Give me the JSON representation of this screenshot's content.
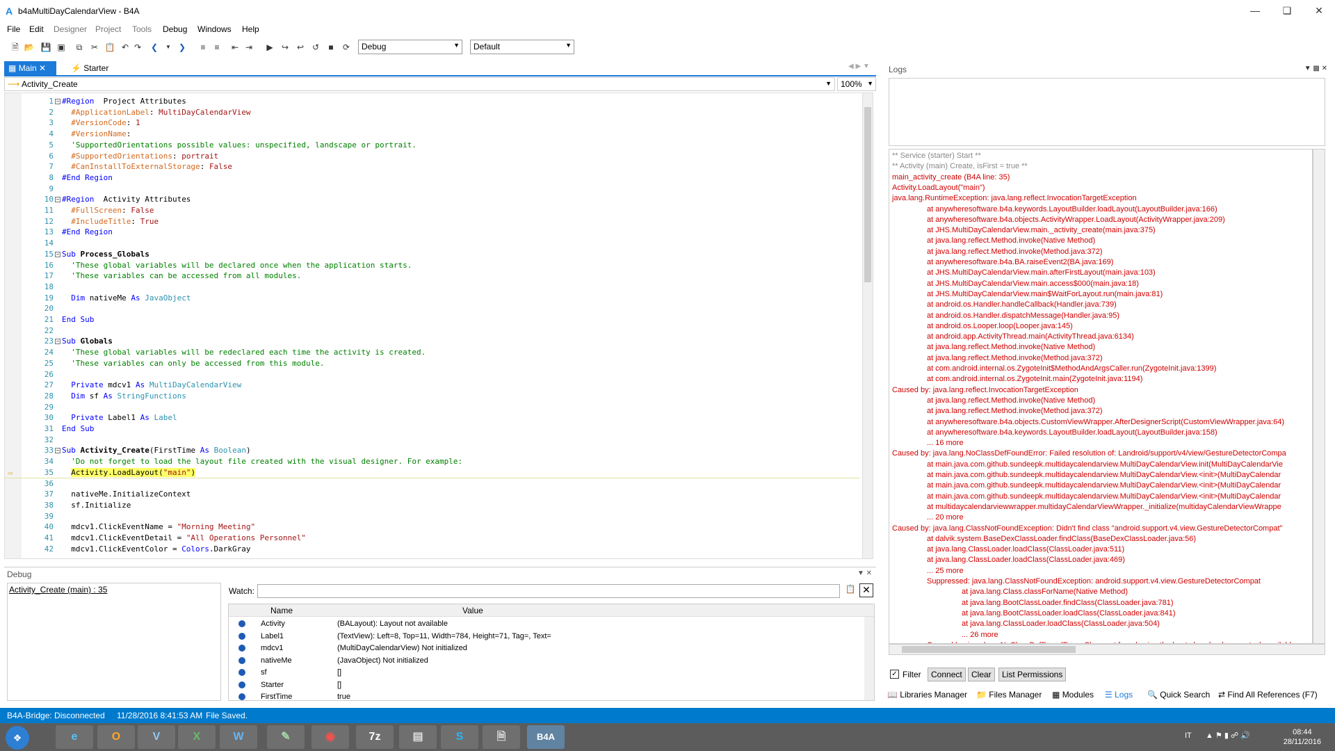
{
  "window": {
    "logo": "A",
    "title": "b4aMultiDayCalendarView - B4A"
  },
  "menu": [
    "File",
    "Edit",
    "Designer",
    "Project",
    "Tools",
    "Debug",
    "Windows",
    "Help"
  ],
  "toolbar": {
    "mode_combo": "Debug",
    "config_combo": "Default"
  },
  "tabs": [
    {
      "label": "Main"
    },
    {
      "label": "Starter"
    }
  ],
  "subs_combo": "Activity_Create",
  "zoom_combo": "100%",
  "code_lines": [
    {
      "n": "1",
      "html": "<span class=\"kw\">#Region</span>  Project Attributes"
    },
    {
      "n": "2",
      "html": "  <span class=\"pp\">#ApplicationLabel</span>: <span class=\"str\">MultiDayCalendarView</span>"
    },
    {
      "n": "3",
      "html": "  <span class=\"pp\">#VersionCode</span>: <span class=\"str\">1</span>"
    },
    {
      "n": "4",
      "html": "  <span class=\"pp\">#VersionName</span>:"
    },
    {
      "n": "5",
      "html": "  <span class=\"cm\">'SupportedOrientations possible values: unspecified, landscape or portrait.</span>"
    },
    {
      "n": "6",
      "html": "  <span class=\"pp\">#SupportedOrientations</span>: <span class=\"str\">portrait</span>"
    },
    {
      "n": "7",
      "html": "  <span class=\"pp\">#CanInstallToExternalStorage</span>: <span class=\"str\">False</span>"
    },
    {
      "n": "8",
      "html": "<span class=\"kw\">#End Region</span>"
    },
    {
      "n": "9",
      "html": ""
    },
    {
      "n": "10",
      "html": "<span class=\"kw\">#Region</span>  Activity Attributes"
    },
    {
      "n": "11",
      "html": "  <span class=\"pp\">#FullScreen</span>: <span class=\"str\">False</span>"
    },
    {
      "n": "12",
      "html": "  <span class=\"pp\">#IncludeTitle</span>: <span class=\"str\">True</span>"
    },
    {
      "n": "13",
      "html": "<span class=\"kw\">#End Region</span>"
    },
    {
      "n": "14",
      "html": ""
    },
    {
      "n": "15",
      "html": "<span class=\"kw\">Sub</span> <b>Process_Globals</b>"
    },
    {
      "n": "16",
      "html": "  <span class=\"cm\">'These global variables will be declared once when the application starts.</span>"
    },
    {
      "n": "17",
      "html": "  <span class=\"cm\">'These variables can be accessed from all modules.</span>"
    },
    {
      "n": "18",
      "html": ""
    },
    {
      "n": "19",
      "html": "  <span class=\"kw\">Dim</span> nativeMe <span class=\"kw\">As</span> <span class=\"ty\">JavaObject</span>"
    },
    {
      "n": "20",
      "html": ""
    },
    {
      "n": "21",
      "html": "<span class=\"kw\">End Sub</span>"
    },
    {
      "n": "22",
      "html": ""
    },
    {
      "n": "23",
      "html": "<span class=\"kw\">Sub</span> <b>Globals</b>"
    },
    {
      "n": "24",
      "html": "  <span class=\"cm\">'These global variables will be redeclared each time the activity is created.</span>"
    },
    {
      "n": "25",
      "html": "  <span class=\"cm\">'These variables can only be accessed from this module.</span>"
    },
    {
      "n": "26",
      "html": ""
    },
    {
      "n": "27",
      "html": "  <span class=\"kw\">Private</span> mdcv1 <span class=\"kw\">As</span> <span class=\"ty\">MultiDayCalendarView</span>"
    },
    {
      "n": "28",
      "html": "  <span class=\"kw\">Dim</span> sf <span class=\"kw\">As</span> <span class=\"ty\">StringFunctions</span>"
    },
    {
      "n": "29",
      "html": ""
    },
    {
      "n": "30",
      "html": "  <span class=\"kw\">Private</span> Label1 <span class=\"kw\">As</span> <span class=\"ty\">Label</span>"
    },
    {
      "n": "31",
      "html": "<span class=\"kw\">End Sub</span>"
    },
    {
      "n": "32",
      "html": ""
    },
    {
      "n": "33",
      "html": "<span class=\"kw\">Sub</span> <b>Activity_Create</b>(FirstTime <span class=\"kw\">As</span> <span class=\"ty\">Boolean</span>)"
    },
    {
      "n": "34",
      "html": "  <span class=\"cm\">'Do not forget to load the layout file created with the visual designer. For example:</span>"
    },
    {
      "n": "35",
      "html": "  <span class=\"hl\">Activity.LoadLayout(<span class=\"str\">\"main\"</span>)</span>",
      "current": true
    },
    {
      "n": "36",
      "html": ""
    },
    {
      "n": "37",
      "html": "  nativeMe.InitializeContext"
    },
    {
      "n": "38",
      "html": "  sf.Initialize"
    },
    {
      "n": "39",
      "html": ""
    },
    {
      "n": "40",
      "html": "  mdcv1.ClickEventName = <span class=\"str\">\"Morning Meeting\"</span>"
    },
    {
      "n": "41",
      "html": "  mdcv1.ClickEventDetail = <span class=\"str\">\"All Operations Personnel\"</span>"
    },
    {
      "n": "42",
      "html": "  mdcv1.ClickEventColor = <span class=\"kw\">Colors</span>.DarkGray"
    }
  ],
  "debug": {
    "title": "Debug",
    "callstack": "Activity_Create (main) : 35",
    "watch_label": "Watch:",
    "col_name": "Name",
    "col_value": "Value",
    "vars": [
      {
        "name": "Activity",
        "value": "(BALayout): Layout not available"
      },
      {
        "name": "Label1",
        "value": "(TextView): Left=8, Top=11, Width=784, Height=71, Tag=, Text="
      },
      {
        "name": "mdcv1",
        "value": "(MultiDayCalendarView) Not initialized"
      },
      {
        "name": "nativeMe",
        "value": "(JavaObject) Not initialized"
      },
      {
        "name": "sf",
        "value": "[]"
      },
      {
        "name": "Starter",
        "value": "[]"
      },
      {
        "name": "FirstTime",
        "value": "true"
      }
    ]
  },
  "logs": {
    "title": "Logs",
    "lines": [
      {
        "t": "** Service (starter) Start **",
        "c": "lg",
        "i": 0
      },
      {
        "t": "** Activity (main) Create, isFirst = true **",
        "c": "lg",
        "i": 0
      },
      {
        "t": "main_activity_create (B4A line: 35)",
        "c": "lr",
        "i": 0
      },
      {
        "t": "Activity.LoadLayout(\"main\")",
        "c": "lr",
        "i": 0
      },
      {
        "t": "java.lang.RuntimeException: java.lang.reflect.InvocationTargetException",
        "c": "lr",
        "i": 0
      },
      {
        "t": "at anywheresoftware.b4a.keywords.LayoutBuilder.loadLayout(LayoutBuilder.java:166)",
        "c": "lr",
        "i": 1
      },
      {
        "t": "at anywheresoftware.b4a.objects.ActivityWrapper.LoadLayout(ActivityWrapper.java:209)",
        "c": "lr",
        "i": 1
      },
      {
        "t": "at JHS.MultiDayCalendarView.main._activity_create(main.java:375)",
        "c": "lr",
        "i": 1
      },
      {
        "t": "at java.lang.reflect.Method.invoke(Native Method)",
        "c": "lr",
        "i": 1
      },
      {
        "t": "at java.lang.reflect.Method.invoke(Method.java:372)",
        "c": "lr",
        "i": 1
      },
      {
        "t": "at anywheresoftware.b4a.BA.raiseEvent2(BA.java:169)",
        "c": "lr",
        "i": 1
      },
      {
        "t": "at JHS.MultiDayCalendarView.main.afterFirstLayout(main.java:103)",
        "c": "lr",
        "i": 1
      },
      {
        "t": "at JHS.MultiDayCalendarView.main.access$000(main.java:18)",
        "c": "lr",
        "i": 1
      },
      {
        "t": "at JHS.MultiDayCalendarView.main$WaitForLayout.run(main.java:81)",
        "c": "lr",
        "i": 1
      },
      {
        "t": "at android.os.Handler.handleCallback(Handler.java:739)",
        "c": "lr",
        "i": 1
      },
      {
        "t": "at android.os.Handler.dispatchMessage(Handler.java:95)",
        "c": "lr",
        "i": 1
      },
      {
        "t": "at android.os.Looper.loop(Looper.java:145)",
        "c": "lr",
        "i": 1
      },
      {
        "t": "at android.app.ActivityThread.main(ActivityThread.java:6134)",
        "c": "lr",
        "i": 1
      },
      {
        "t": "at java.lang.reflect.Method.invoke(Native Method)",
        "c": "lr",
        "i": 1
      },
      {
        "t": "at java.lang.reflect.Method.invoke(Method.java:372)",
        "c": "lr",
        "i": 1
      },
      {
        "t": "at com.android.internal.os.ZygoteInit$MethodAndArgsCaller.run(ZygoteInit.java:1399)",
        "c": "lr",
        "i": 1
      },
      {
        "t": "at com.android.internal.os.ZygoteInit.main(ZygoteInit.java:1194)",
        "c": "lr",
        "i": 1
      },
      {
        "t": "Caused by: java.lang.reflect.InvocationTargetException",
        "c": "lr",
        "i": 0
      },
      {
        "t": "at java.lang.reflect.Method.invoke(Native Method)",
        "c": "lr",
        "i": 1
      },
      {
        "t": "at java.lang.reflect.Method.invoke(Method.java:372)",
        "c": "lr",
        "i": 1
      },
      {
        "t": "at anywheresoftware.b4a.objects.CustomViewWrapper.AfterDesignerScript(CustomViewWrapper.java:64)",
        "c": "lr",
        "i": 1
      },
      {
        "t": "at anywheresoftware.b4a.keywords.LayoutBuilder.loadLayout(LayoutBuilder.java:158)",
        "c": "lr",
        "i": 1
      },
      {
        "t": "... 16 more",
        "c": "lr",
        "i": 1
      },
      {
        "t": "Caused by: java.lang.NoClassDefFoundError: Failed resolution of: Landroid/support/v4/view/GestureDetectorCompa",
        "c": "lr",
        "i": 0
      },
      {
        "t": "at main.java.com.github.sundeepk.multidaycalendarview.MultiDayCalendarView.init(MultiDayCalendarVie",
        "c": "lr",
        "i": 1
      },
      {
        "t": "at main.java.com.github.sundeepk.multidaycalendarview.MultiDayCalendarView.<init>(MultiDayCalendar",
        "c": "lr",
        "i": 1
      },
      {
        "t": "at main.java.com.github.sundeepk.multidaycalendarview.MultiDayCalendarView.<init>(MultiDayCalendar",
        "c": "lr",
        "i": 1
      },
      {
        "t": "at main.java.com.github.sundeepk.multidaycalendarview.MultiDayCalendarView.<init>(MultiDayCalendar",
        "c": "lr",
        "i": 1
      },
      {
        "t": "at multidaycalendarviewwrapper.multidayCalendarViewWrapper._initialize(multidayCalendarViewWrappe",
        "c": "lr",
        "i": 1
      },
      {
        "t": "... 20 more",
        "c": "lr",
        "i": 1
      },
      {
        "t": "Caused by: java.lang.ClassNotFoundException: Didn't find class \"android.support.v4.view.GestureDetectorCompat\"",
        "c": "lr",
        "i": 0
      },
      {
        "t": "at dalvik.system.BaseDexClassLoader.findClass(BaseDexClassLoader.java:56)",
        "c": "lr",
        "i": 1
      },
      {
        "t": "at java.lang.ClassLoader.loadClass(ClassLoader.java:511)",
        "c": "lr",
        "i": 1
      },
      {
        "t": "at java.lang.ClassLoader.loadClass(ClassLoader.java:469)",
        "c": "lr",
        "i": 1
      },
      {
        "t": "... 25 more",
        "c": "lr",
        "i": 1
      },
      {
        "t": "Suppressed: java.lang.ClassNotFoundException: android.support.v4.view.GestureDetectorCompat",
        "c": "lr",
        "i": 1
      },
      {
        "t": "at java.lang.Class.classForName(Native Method)",
        "c": "lr",
        "i": 2
      },
      {
        "t": "at java.lang.BootClassLoader.findClass(ClassLoader.java:781)",
        "c": "lr",
        "i": 2
      },
      {
        "t": "at java.lang.BootClassLoader.loadClass(ClassLoader.java:841)",
        "c": "lr",
        "i": 2
      },
      {
        "t": "at java.lang.ClassLoader.loadClass(ClassLoader.java:504)",
        "c": "lr",
        "i": 2
      },
      {
        "t": "... 26 more",
        "c": "lr",
        "i": 2
      },
      {
        "t": "Caused by: java.lang.NoClassDefFoundError: Class not found using the boot class loader; no stack available",
        "c": "lr",
        "i": 1
      }
    ],
    "filter_label": "Filter",
    "connect": "Connect",
    "clear": "Clear",
    "list_permissions": "List Permissions"
  },
  "bottom_tabs": [
    {
      "icon": "book-icon",
      "label": "Libraries Manager"
    },
    {
      "icon": "folder-icon",
      "label": "Files Manager"
    },
    {
      "icon": "modules-icon",
      "label": "Modules"
    },
    {
      "icon": "list-icon",
      "label": "Logs"
    },
    {
      "icon": "search-icon",
      "label": "Quick Search"
    },
    {
      "icon": "find-references-icon",
      "label": "Find All References (F7)"
    }
  ],
  "status": {
    "bridge": "B4A-Bridge: Disconnected",
    "time": "11/28/2016 8:41:53 AM",
    "message": "File Saved."
  },
  "taskbar": {
    "lang": "IT",
    "clock_time": "08:44",
    "clock_date": "28/11/2016",
    "b4a_label": "B4A"
  },
  "colors": {
    "accent": "#007acc",
    "tab_active": "#1c7ad9",
    "error": "#d00000"
  }
}
